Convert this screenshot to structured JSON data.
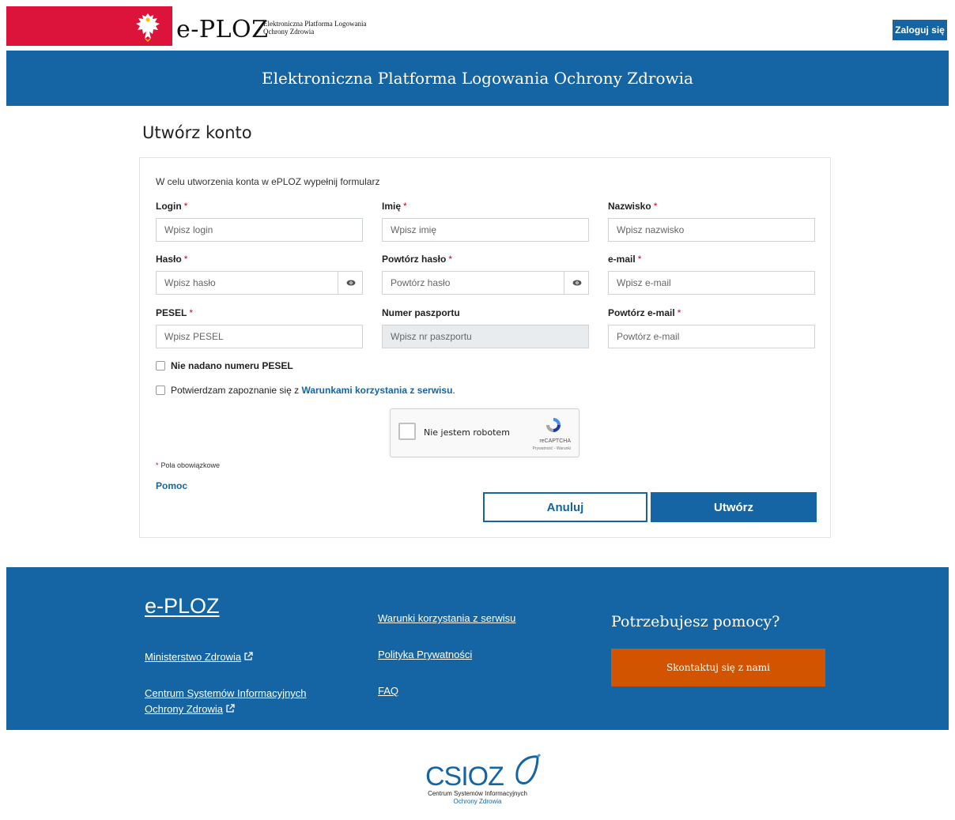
{
  "header": {
    "brand": "e-PLOZ",
    "brand_sub_line1": "Elektroniczna Platforma Logowania",
    "brand_sub_line2": "Ochrony Zdrowia",
    "login_label": "Zaloguj się",
    "accent_red": "#dc143c",
    "accent_blue": "#1565a4"
  },
  "banner": {
    "title": "Elektroniczna Platforma Logowania Ochrony Zdrowia"
  },
  "page": {
    "title": "Utwórz konto"
  },
  "form": {
    "intro": "W celu utworzenia konta w ePLOZ wypełnij formularz",
    "required_mark": "*",
    "fields": {
      "login": {
        "label": "Login",
        "placeholder": "Wpisz login",
        "required": true
      },
      "first_name": {
        "label": "Imię",
        "placeholder": "Wpisz imię",
        "required": true
      },
      "last_name": {
        "label": "Nazwisko",
        "placeholder": "Wpisz nazwisko",
        "required": true
      },
      "password": {
        "label": "Hasło",
        "placeholder": "Wpisz hasło",
        "required": true
      },
      "password_repeat": {
        "label": "Powtórz hasło",
        "placeholder": "Powtórz hasło",
        "required": true
      },
      "email": {
        "label": "e-mail",
        "placeholder": "Wpisz e-mail",
        "required": true
      },
      "pesel": {
        "label": "PESEL",
        "placeholder": "Wpisz PESEL",
        "required": true
      },
      "passport": {
        "label": "Numer paszportu",
        "placeholder": "Wpisz nr paszportu",
        "required": false,
        "disabled": true
      },
      "email_repeat": {
        "label": "Powtórz e-mail",
        "placeholder": "Powtórz e-mail",
        "required": true
      }
    },
    "no_pesel_label": "Nie nadano numeru PESEL",
    "terms_prefix": "Potwierdzam zapoznanie się z",
    "terms_link": "Warunkami korzystania z serwisu",
    "terms_suffix": ".",
    "captcha": {
      "label": "Nie jestem robotem",
      "brand": "reCAPTCHA",
      "links": "Prywatność - Warunki"
    },
    "required_note": "Pola obowiązkowe",
    "help_link": "Pomoc",
    "cancel_label": "Anuluj",
    "create_label": "Utwórz"
  },
  "footer": {
    "brand": "e-PLOZ",
    "links_col1": [
      "Ministerstwo Zdrowia",
      "Centrum Systemów Informacyjnych",
      "Ochrony Zdrowia"
    ],
    "links_col2": [
      "Warunki korzystania z serwisu",
      "Polityka Prywatności",
      "FAQ"
    ],
    "help_title": "Potrzebujesz pomocy?",
    "contact_label": "Skontaktuj się z nami",
    "contact_color": "#d35400"
  },
  "bottom": {
    "logo_text": "CSIOZ",
    "sub_line1": "Centrum Systemów Informacyjnych",
    "sub_line2": "Ochrony Zdrowia"
  }
}
